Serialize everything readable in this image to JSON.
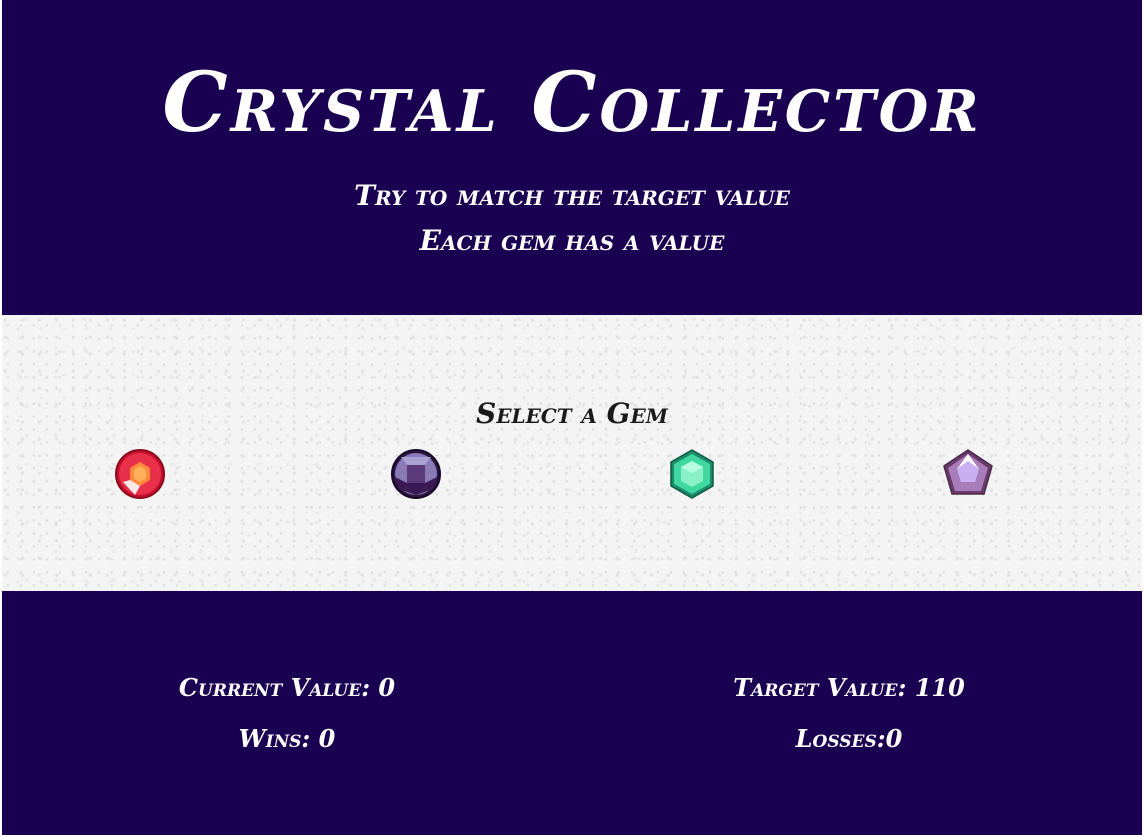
{
  "header": {
    "title": "Crystal Collector",
    "subtitle_1": "Try to match the target value",
    "subtitle_2": "Each gem has a value"
  },
  "game": {
    "select_label": "Select a Gem",
    "gems": [
      {
        "name": "ruby",
        "icon": "ruby-gem-icon",
        "color": "#e8304a"
      },
      {
        "name": "amethyst",
        "icon": "amethyst-gem-icon",
        "color": "#5a3a7a"
      },
      {
        "name": "emerald",
        "icon": "emerald-gem-icon",
        "color": "#3ed8a0"
      },
      {
        "name": "pearl",
        "icon": "pearl-gem-icon",
        "color": "#a87cb8"
      }
    ]
  },
  "stats": {
    "current_value": "Current Value: 0",
    "wins": "Wins: 0",
    "target_value": "Target Value: 110",
    "losses": "Losses:0"
  },
  "colors": {
    "primary_bg": "#1a0050",
    "text_light": "#ffffff",
    "text_dark": "#1a1a1a"
  }
}
